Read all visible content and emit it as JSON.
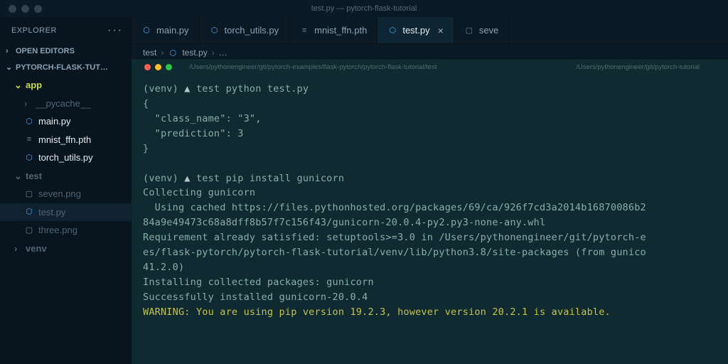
{
  "window": {
    "title": "test.py — pytorch-flask-tutorial"
  },
  "explorer": {
    "header": "EXPLORER",
    "open_editors": "OPEN EDITORS",
    "project": "PYTORCH-FLASK-TUT…"
  },
  "tree": {
    "app": "app",
    "pycache": "__pycache__",
    "main": "main.py",
    "mnist": "mnist_ffn.pth",
    "torch_utils": "torch_utils.py",
    "test": "test",
    "seven": "seven.png",
    "testpy": "test.py",
    "three": "three.png",
    "venv": "venv"
  },
  "tabs": [
    {
      "label": "main.py",
      "icon": "py"
    },
    {
      "label": "torch_utils.py",
      "icon": "py"
    },
    {
      "label": "mnist_ffn.pth",
      "icon": "file"
    },
    {
      "label": "test.py",
      "icon": "py",
      "active": true
    },
    {
      "label": "seve",
      "icon": "img"
    }
  ],
  "breadcrumb": {
    "root": "test",
    "file": "test.py",
    "more": "…"
  },
  "terminal": {
    "path_left": "/Users/pythonengineer/git/pytorch-examples/flask-pytorch/pytorch-flask-tutorial/test",
    "path_right": "/Users/pythonengineer/git/pytorch-tutorial",
    "lines": {
      "l1a": "(venv) ",
      "l1b": "▲",
      "l1c": " test python test.py",
      "l2": "{",
      "l3": "  \"class_name\": \"3\",",
      "l4": "  \"prediction\": 3",
      "l5": "}",
      "l6": "",
      "l7a": "(venv) ",
      "l7b": "▲",
      "l7c": " test pip install gunicorn",
      "l8": "Collecting gunicorn",
      "l9": "  Using cached https://files.pythonhosted.org/packages/69/ca/926f7cd3a2014b16870086b2",
      "l10": "84a9e49473c68a8dff8b57f7c156f43/gunicorn-20.0.4-py2.py3-none-any.whl",
      "l11": "Requirement already satisfied: setuptools>=3.0 in /Users/pythonengineer/git/pytorch-e",
      "l12": "es/flask-pytorch/pytorch-flask-tutorial/venv/lib/python3.8/site-packages (from gunico",
      "l13": "41.2.0)",
      "l14": "Installing collected packages: gunicorn",
      "l15": "Successfully installed gunicorn-20.0.4",
      "l16": "WARNING: You are using pip version 19.2.3, however version 20.2.1 is available."
    }
  }
}
